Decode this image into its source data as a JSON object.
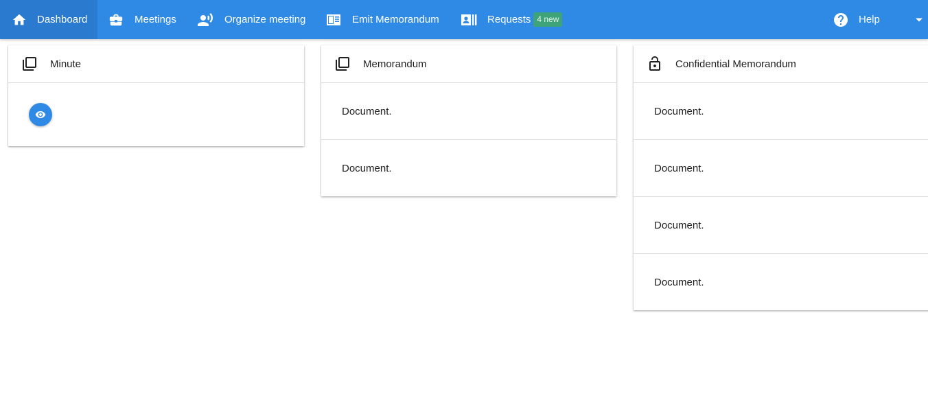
{
  "navbar": {
    "items": [
      {
        "label": "Dashboard",
        "icon": "home-icon",
        "active": true
      },
      {
        "label": "Meetings",
        "icon": "briefcase-icon"
      },
      {
        "label": "Organize meeting",
        "icon": "record-voice-icon"
      },
      {
        "label": "Emit Memorandum",
        "icon": "newspaper-icon"
      },
      {
        "label": "Requests",
        "icon": "contact-list-icon",
        "badge": "4 new"
      }
    ],
    "help": {
      "label": "Help",
      "icon": "help-circle-icon"
    },
    "menu_icon": "caret-down-icon"
  },
  "cards": {
    "minute": {
      "title": "Minute",
      "icon": "library-books-icon",
      "action_icon": "eye-icon"
    },
    "memorandum": {
      "title": "Memorandum",
      "icon": "library-books-icon",
      "documents": [
        "Document.",
        "Document."
      ]
    },
    "confidential": {
      "title": "Confidential Memorandum",
      "icon": "lock-icon",
      "documents": [
        "Document.",
        "Document.",
        "Document.",
        "Document."
      ]
    }
  },
  "colors": {
    "navbar": "#2f8ae5",
    "navbar_active": "#2a7ad0",
    "badge": "#3fa37a"
  }
}
